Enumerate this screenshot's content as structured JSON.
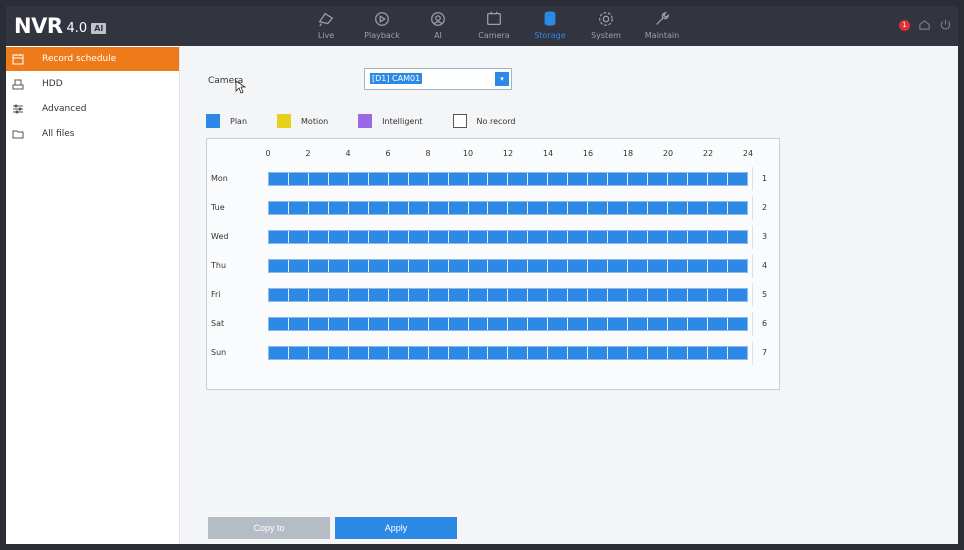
{
  "app": {
    "logo_main": "NVR",
    "logo_version": "4.0",
    "logo_badge": "AI"
  },
  "nav": [
    {
      "label": "Live",
      "icon": "live-icon",
      "active": false
    },
    {
      "label": "Playback",
      "icon": "playback-icon",
      "active": false
    },
    {
      "label": "AI",
      "icon": "ai-icon",
      "active": false
    },
    {
      "label": "Camera",
      "icon": "camera-icon",
      "active": false
    },
    {
      "label": "Storage",
      "icon": "storage-icon",
      "active": true
    },
    {
      "label": "System",
      "icon": "gear-icon",
      "active": false
    },
    {
      "label": "Maintain",
      "icon": "wrench-icon",
      "active": false
    }
  ],
  "topright": {
    "alarm_count": "1"
  },
  "sidebar": {
    "items": [
      {
        "label": "Record schedule",
        "icon": "calendar-icon",
        "active": true
      },
      {
        "label": "HDD",
        "icon": "hdd-icon",
        "active": false
      },
      {
        "label": "Advanced",
        "icon": "sliders-icon",
        "active": false
      },
      {
        "label": "All files",
        "icon": "folder-icon",
        "active": false
      }
    ]
  },
  "camera": {
    "label": "Camera",
    "value": "[D1] CAM01"
  },
  "legend": [
    {
      "label": "Plan",
      "color": "#2d89e6"
    },
    {
      "label": "Motion",
      "color": "#e6d21a"
    },
    {
      "label": "Intelligent",
      "color": "#9a6ae6"
    },
    {
      "label": "No record",
      "color": "#ffffff"
    }
  ],
  "schedule": {
    "hours": [
      "0",
      "2",
      "4",
      "6",
      "8",
      "10",
      "12",
      "14",
      "16",
      "18",
      "20",
      "22",
      "24"
    ],
    "days": [
      {
        "name": "Mon",
        "index": "1"
      },
      {
        "name": "Tue",
        "index": "2"
      },
      {
        "name": "Wed",
        "index": "3"
      },
      {
        "name": "Thu",
        "index": "4"
      },
      {
        "name": "Fri",
        "index": "5"
      },
      {
        "name": "Sat",
        "index": "6"
      },
      {
        "name": "Sun",
        "index": "7"
      }
    ],
    "plan_color": "#2d89e6"
  },
  "buttons": {
    "copy_to": "Copy to",
    "apply": "Apply"
  }
}
